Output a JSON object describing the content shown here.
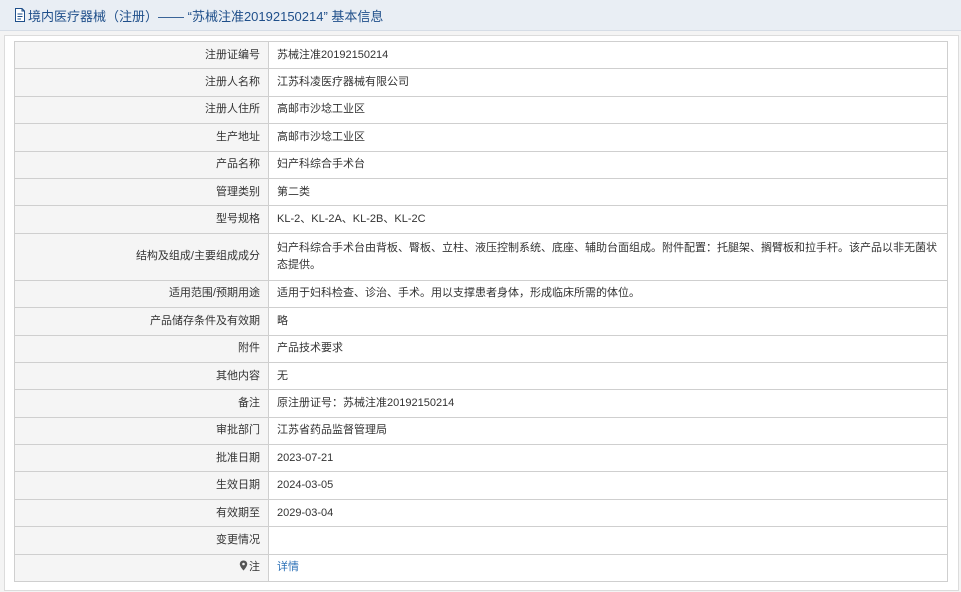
{
  "header": {
    "title": "境内医疗器械（注册）—— “苏械注准20192150214” 基本信息",
    "icon": "document-icon",
    "color": "#1f4f8a"
  },
  "rows": [
    {
      "label": "注册证编号",
      "value": "苏械注准20192150214"
    },
    {
      "label": "注册人名称",
      "value": "江苏科凌医疗器械有限公司"
    },
    {
      "label": "注册人住所",
      "value": "高邮市沙埝工业区"
    },
    {
      "label": "生产地址",
      "value": "高邮市沙埝工业区"
    },
    {
      "label": "产品名称",
      "value": "妇产科综合手术台"
    },
    {
      "label": "管理类别",
      "value": "第二类"
    },
    {
      "label": "型号规格",
      "value": "KL-2、KL-2A、KL-2B、KL-2C"
    },
    {
      "label": "结构及组成/主要组成成分",
      "value": "妇产科综合手术台由背板、臀板、立柱、液压控制系统、底座、辅助台面组成。附件配置：托腿架、搁臂板和拉手杆。该产品以非无菌状态提供。"
    },
    {
      "label": "适用范围/预期用途",
      "value": "适用于妇科检查、诊治、手术。用以支撑患者身体，形成临床所需的体位。"
    },
    {
      "label": "产品储存条件及有效期",
      "value": "略"
    },
    {
      "label": "附件",
      "value": "产品技术要求"
    },
    {
      "label": "其他内容",
      "value": "无"
    },
    {
      "label": "备注",
      "value": "原注册证号：苏械注准20192150214"
    },
    {
      "label": "审批部门",
      "value": "江苏省药品监督管理局"
    },
    {
      "label": "批准日期",
      "value": "2023-07-21"
    },
    {
      "label": "生效日期",
      "value": "2024-03-05"
    },
    {
      "label": "有效期至",
      "value": "2029-03-04"
    },
    {
      "label": "变更情况",
      "value": ""
    }
  ],
  "note": {
    "label": "注",
    "icon": "pin-icon",
    "link_text": "详情",
    "link_color": "#2a6fb6"
  }
}
